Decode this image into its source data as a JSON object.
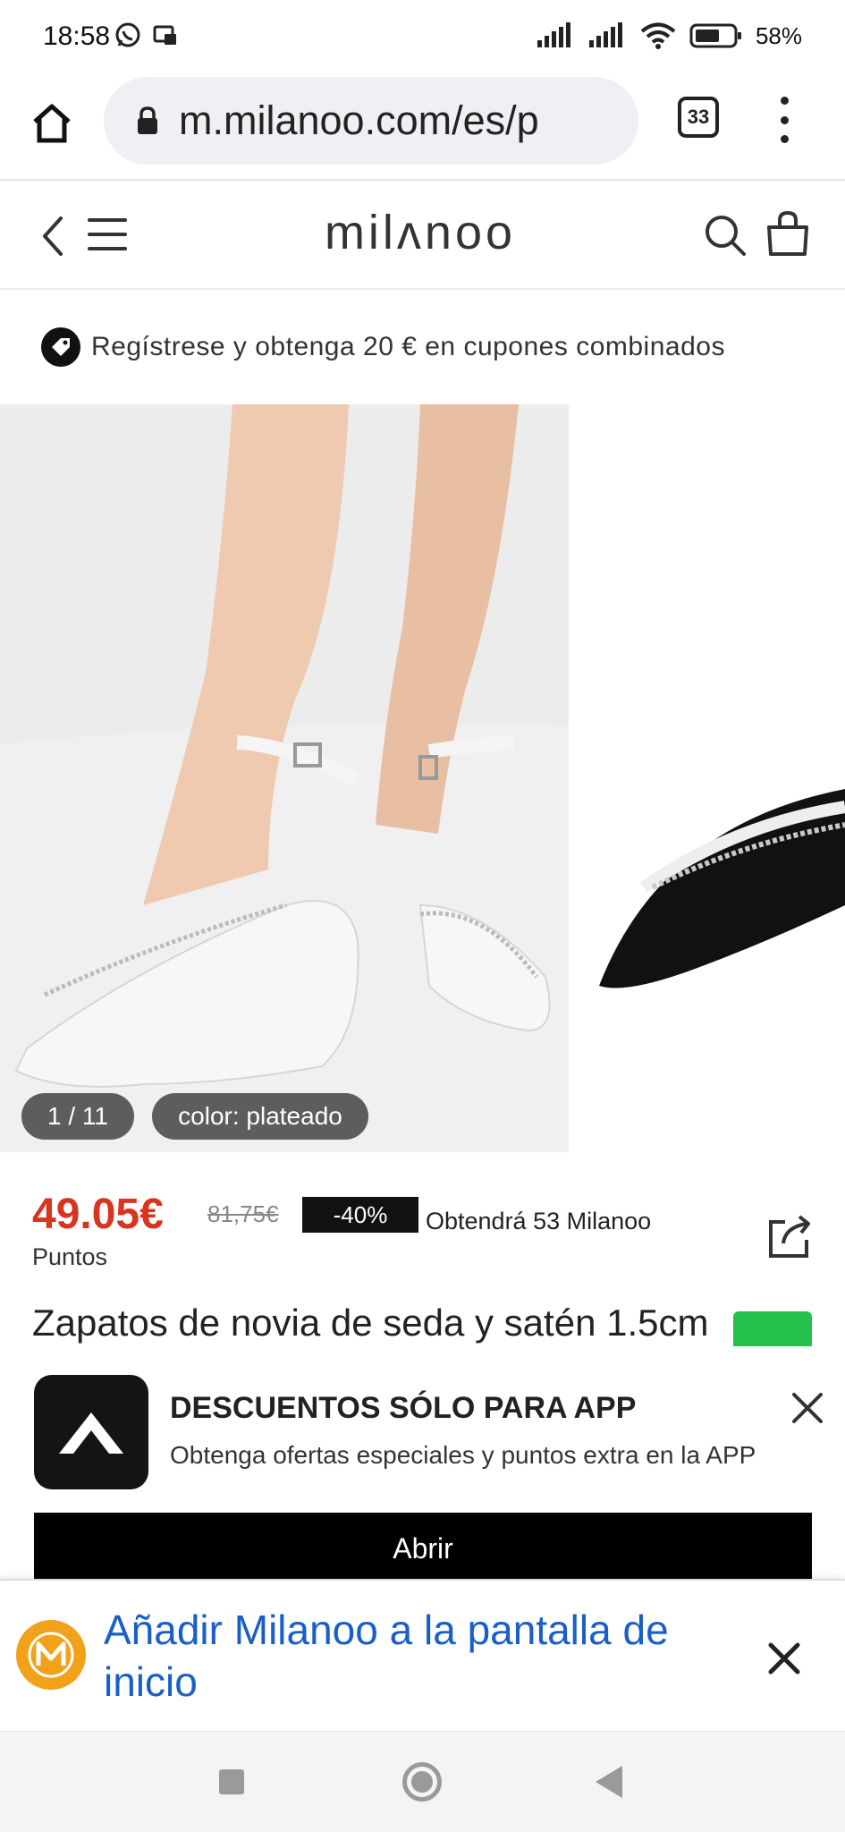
{
  "status_bar": {
    "time": "18:58",
    "battery": "58%"
  },
  "browser": {
    "url": "m.milanoo.com/es/p",
    "tab_count": "33"
  },
  "site": {
    "logo_text": "milʌnoo"
  },
  "promo": {
    "text": "Regístrese y obtenga 20 € en cupones combinados"
  },
  "gallery": {
    "counter": "1 / 11",
    "color_label": "color: plateado"
  },
  "product": {
    "price": "49.05€",
    "old_price": "81,75€",
    "discount": "-40%",
    "points_text": "Obtendrá 53 Milanoo",
    "points_suffix": "Puntos",
    "title": "Zapatos de novia de seda y satén 1.5cm"
  },
  "app_banner": {
    "title": "DESCUENTOS SÓLO PARA APP",
    "subtitle": "Obtenga ofertas especiales y puntos extra en la APP",
    "open_label": "Abrir"
  },
  "add_to_home": {
    "text": "Añadir Milanoo a la pantalla de inicio"
  },
  "colors": {
    "price": "#d8341f",
    "link_blue": "#1a5fc6",
    "whatsapp": "#23c04b",
    "icon_orange": "#f2a11b"
  }
}
